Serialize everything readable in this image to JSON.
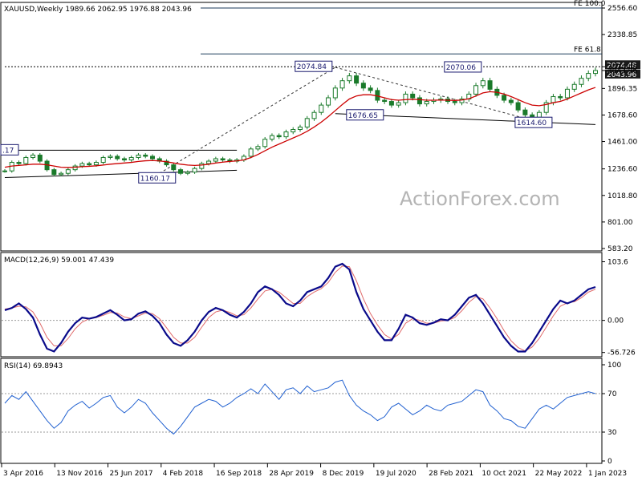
{
  "header": {
    "price_title": "XAUUSD,Weekly  1989.66 2062.95 1976.88 2043.96",
    "macd_title": "MACD(12,26,9) 59.001 47.439",
    "rsi_title": "RSI(14) 69.8943"
  },
  "watermark": "ActionForex.com",
  "colors": {
    "candle": "#1a7a2a",
    "ma": "#cc0000",
    "macd": "#0a0a8a",
    "signal": "#e06a6a",
    "rsi": "#2060d0",
    "trend": "#000000",
    "level_tag_bg": "#1a1a6e"
  },
  "chart_data": [
    {
      "type": "candlestick",
      "name": "price",
      "x_ticks": [
        "3 Apr 2016",
        "13 Nov 2016",
        "25 Jun 2017",
        "4 Feb 2018",
        "16 Sep 2018",
        "28 Apr 2019",
        "8 Dec 2019",
        "19 Jul 2020",
        "28 Feb 2021",
        "10 Oct 2021",
        "22 May 2022",
        "1 Jan 2023"
      ],
      "y_ticks": [
        "2556.60",
        "2338.85",
        "2074.48",
        "2043.96",
        "1896.35",
        "1678.60",
        "1461.00",
        "1236.60",
        "1018.80",
        "801.00",
        "583.20"
      ],
      "ylim": [
        583.2,
        2556.6
      ],
      "current_price": 2043.96,
      "closes": [
        1220,
        1290,
        1280,
        1330,
        1350,
        1300,
        1230,
        1190,
        1200,
        1230,
        1260,
        1280,
        1270,
        1290,
        1330,
        1340,
        1320,
        1310,
        1330,
        1350,
        1340,
        1320,
        1300,
        1270,
        1230,
        1200,
        1210,
        1240,
        1280,
        1300,
        1320,
        1310,
        1300,
        1310,
        1340,
        1400,
        1420,
        1480,
        1510,
        1500,
        1540,
        1560,
        1580,
        1650,
        1700,
        1760,
        1820,
        1900,
        1960,
        2000,
        1940,
        1900,
        1880,
        1800,
        1790,
        1760,
        1780,
        1850,
        1820,
        1770,
        1790,
        1800,
        1810,
        1790,
        1780,
        1810,
        1850,
        1920,
        1960,
        1890,
        1840,
        1800,
        1780,
        1720,
        1680,
        1660,
        1700,
        1780,
        1830,
        1820,
        1890,
        1930,
        1980,
        2020,
        2043.96
      ],
      "ma": [
        1250,
        1260,
        1265,
        1270,
        1275,
        1275,
        1270,
        1260,
        1250,
        1248,
        1250,
        1255,
        1258,
        1262,
        1268,
        1275,
        1280,
        1285,
        1290,
        1298,
        1303,
        1305,
        1302,
        1295,
        1285,
        1275,
        1268,
        1265,
        1268,
        1275,
        1285,
        1292,
        1298,
        1302,
        1310,
        1330,
        1355,
        1385,
        1415,
        1440,
        1465,
        1490,
        1515,
        1545,
        1580,
        1620,
        1665,
        1715,
        1765,
        1810,
        1835,
        1845,
        1845,
        1835,
        1820,
        1805,
        1800,
        1805,
        1808,
        1805,
        1800,
        1800,
        1802,
        1800,
        1798,
        1802,
        1812,
        1835,
        1860,
        1870,
        1865,
        1850,
        1830,
        1805,
        1780,
        1760,
        1755,
        1765,
        1780,
        1790,
        1810,
        1835,
        1860,
        1885,
        1905
      ],
      "levels": [
        {
          "label": "FE 100.0",
          "value": 2556.6
        },
        {
          "label": "FE 61.8",
          "value": 2180
        }
      ],
      "tags": [
        {
          "label": "2074.84",
          "value": 2074.84
        },
        {
          "label": "2070.06",
          "value": 2070.06
        },
        {
          "label": "1676.65",
          "value": 1676.65
        },
        {
          "label": "1614.60",
          "value": 1614.6
        },
        {
          "label": "1160.17",
          "value": 1160.17
        },
        {
          "label": ".17",
          "value": 1390
        }
      ],
      "price_tags": [
        {
          "label": "2074.48",
          "value": 2074.48
        },
        {
          "label": "2043.96",
          "value": 2043.96
        }
      ]
    },
    {
      "type": "line",
      "name": "MACD(12,26,9)",
      "y_ticks": [
        "103.6",
        "0.00",
        "-56.726"
      ],
      "ylim": [
        -60,
        110
      ],
      "macd": [
        18,
        22,
        30,
        20,
        5,
        -25,
        -50,
        -55,
        -40,
        -20,
        -5,
        5,
        3,
        6,
        12,
        18,
        10,
        0,
        2,
        12,
        16,
        8,
        -5,
        -25,
        -40,
        -45,
        -35,
        -20,
        0,
        15,
        22,
        18,
        10,
        5,
        15,
        30,
        50,
        60,
        55,
        45,
        30,
        25,
        35,
        50,
        55,
        60,
        75,
        95,
        100,
        90,
        50,
        20,
        0,
        -20,
        -35,
        -35,
        -15,
        10,
        5,
        -5,
        -8,
        -4,
        2,
        0,
        10,
        25,
        40,
        45,
        30,
        10,
        -10,
        -30,
        -45,
        -55,
        -55,
        -40,
        -20,
        0,
        20,
        35,
        30,
        35,
        45,
        55,
        59
      ],
      "signal": [
        20,
        22,
        25,
        24,
        15,
        -5,
        -30,
        -45,
        -45,
        -32,
        -15,
        -3,
        3,
        5,
        9,
        14,
        13,
        6,
        3,
        8,
        13,
        12,
        3,
        -13,
        -30,
        -40,
        -40,
        -30,
        -12,
        5,
        15,
        18,
        14,
        8,
        10,
        22,
        38,
        52,
        55,
        50,
        40,
        30,
        30,
        42,
        50,
        56,
        67,
        85,
        96,
        95,
        70,
        38,
        12,
        -8,
        -25,
        -33,
        -25,
        -5,
        3,
        0,
        -5,
        -5,
        -1,
        0,
        5,
        17,
        32,
        42,
        38,
        22,
        3,
        -18,
        -36,
        -48,
        -54,
        -47,
        -32,
        -12,
        8,
        25,
        31,
        33,
        40,
        50,
        55
      ]
    },
    {
      "type": "line",
      "name": "RSI(14)",
      "y_ticks": [
        "100",
        "70",
        "30",
        "0"
      ],
      "ylim": [
        0,
        100
      ],
      "reference_levels": [
        70,
        30
      ],
      "values": [
        60,
        68,
        64,
        72,
        62,
        52,
        42,
        34,
        40,
        52,
        58,
        62,
        55,
        60,
        66,
        68,
        56,
        50,
        56,
        64,
        60,
        50,
        42,
        34,
        28,
        36,
        46,
        56,
        60,
        64,
        62,
        56,
        60,
        66,
        70,
        75,
        70,
        80,
        72,
        64,
        74,
        76,
        70,
        78,
        72,
        74,
        76,
        82,
        84,
        68,
        58,
        52,
        48,
        42,
        46,
        56,
        60,
        54,
        48,
        52,
        58,
        54,
        52,
        58,
        60,
        62,
        68,
        74,
        72,
        58,
        52,
        44,
        42,
        36,
        34,
        44,
        54,
        58,
        54,
        60,
        66,
        68,
        70,
        72,
        70
      ]
    }
  ]
}
